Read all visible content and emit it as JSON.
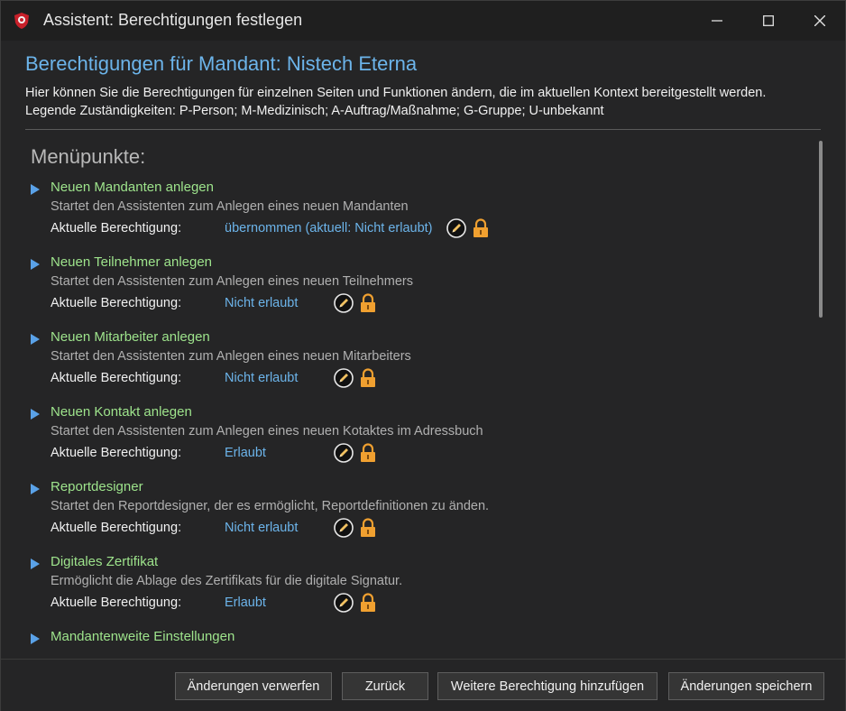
{
  "window": {
    "title": "Assistent: Berechtigungen festlegen",
    "controls": [
      "minimize",
      "maximize",
      "close"
    ]
  },
  "header": {
    "title": "Berechtigungen für Mandant: Nistech Eterna",
    "line1": "Hier können Sie die Berechtigungen für einzelnen Seiten und Funktionen ändern, die im aktuellen Kontext bereitgestellt werden.",
    "line2": "Legende Zuständigkeiten: P-Person; M-Medizinisch; A-Auftrag/Maßnahme; G-Gruppe; U-unbekannt"
  },
  "section": {
    "heading": "Menüpunkte:"
  },
  "perm_label": "Aktuelle Berechtigung:",
  "items": [
    {
      "title": "Neuen Mandanten anlegen",
      "desc": "Startet den Assistenten zum Anlegen eines neuen Mandanten",
      "value": "übernommen (aktuell: Nicht erlaubt)"
    },
    {
      "title": "Neuen Teilnehmer anlegen",
      "desc": "Startet den Assistenten zum Anlegen eines neuen Teilnehmers",
      "value": "Nicht erlaubt"
    },
    {
      "title": "Neuen Mitarbeiter anlegen",
      "desc": "Startet den Assistenten zum Anlegen eines neuen Mitarbeiters",
      "value": "Nicht erlaubt"
    },
    {
      "title": "Neuen Kontakt anlegen",
      "desc": "Startet den Assistenten zum Anlegen eines neuen Kotaktes im Adressbuch",
      "value": "Erlaubt"
    },
    {
      "title": "Reportdesigner",
      "desc": "Startet den Reportdesigner, der es ermöglicht, Reportdefinitionen zu änden.",
      "value": "Nicht erlaubt"
    },
    {
      "title": "Digitales Zertifikat",
      "desc": "Ermöglicht die Ablage des Zertifikats für die digitale Signatur.",
      "value": "Erlaubt"
    },
    {
      "title": "Mandantenweite Einstellungen"
    }
  ],
  "icons": {
    "app": "shield-icon",
    "expand": "triangle-right-icon",
    "edit": "pencil-icon",
    "lock": "lock-icon"
  },
  "colors": {
    "accent_blue": "#6cb4ea",
    "item_green": "#9ee48c",
    "lock_orange": "#f0a030"
  },
  "footer": {
    "discard": "Änderungen verwerfen",
    "back": "Zurück",
    "add_permission": "Weitere Berechtigung hinzufügen",
    "save": "Änderungen speichern"
  }
}
